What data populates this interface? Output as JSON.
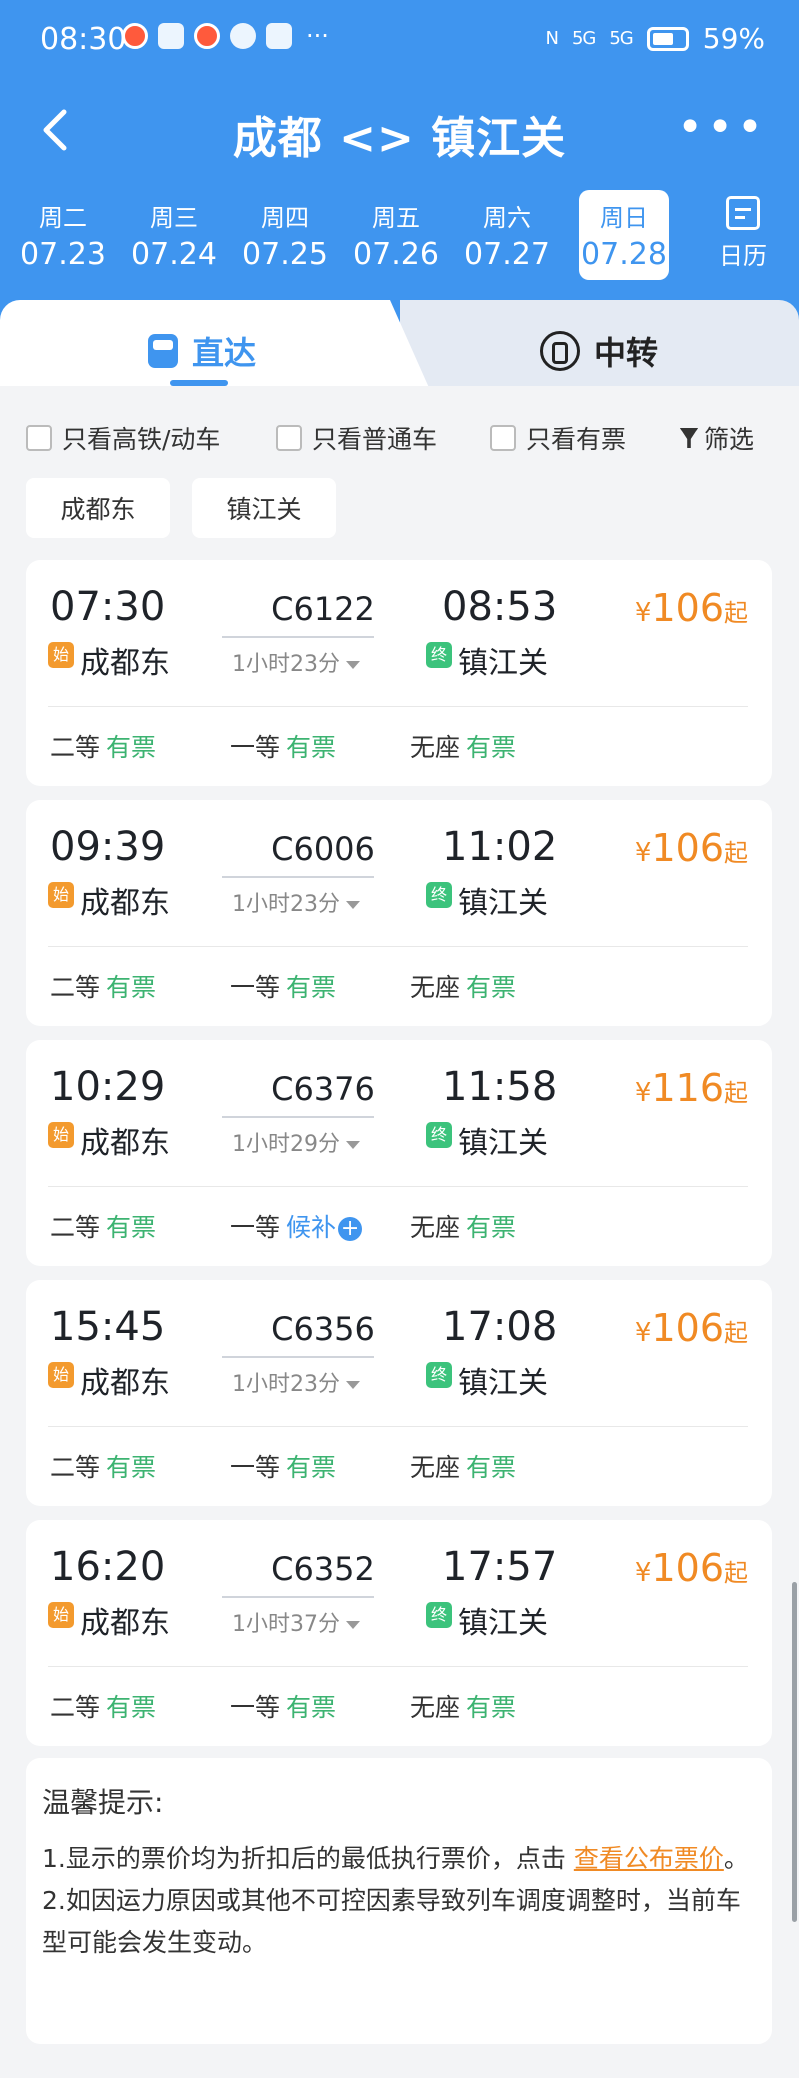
{
  "status": {
    "time": "08:30",
    "more": "···",
    "net1": "5G",
    "net2": "5G",
    "battery": "59%"
  },
  "header": {
    "title": "成都 <> 镇江关",
    "more": "•••",
    "calendar_label": "日历",
    "dates": [
      {
        "week": "周二",
        "date": "07.23"
      },
      {
        "week": "周三",
        "date": "07.24"
      },
      {
        "week": "周四",
        "date": "07.25"
      },
      {
        "week": "周五",
        "date": "07.26"
      },
      {
        "week": "周六",
        "date": "07.27"
      },
      {
        "week": "周日",
        "date": "07.28",
        "selected": true
      }
    ]
  },
  "tabs": {
    "direct": "直达",
    "transfer": "中转"
  },
  "filters": {
    "high_speed": "只看高铁/动车",
    "normal": "只看普通车",
    "available": "只看有票",
    "screen": "筛选"
  },
  "station_chips": [
    "成都东",
    "镇江关"
  ],
  "badges": {
    "start": "始",
    "end": "终"
  },
  "trains": [
    {
      "dep": "07:30",
      "no": "C6122",
      "arr": "08:53",
      "dur": "1小时23分",
      "from": "成都东",
      "to": "镇江关",
      "yen": "¥",
      "price": "106",
      "suffix": "起",
      "seats": [
        {
          "cls": "二等",
          "st": "有票"
        },
        {
          "cls": "一等",
          "st": "有票"
        },
        {
          "cls": "无座",
          "st": "有票"
        }
      ]
    },
    {
      "dep": "09:39",
      "no": "C6006",
      "arr": "11:02",
      "dur": "1小时23分",
      "from": "成都东",
      "to": "镇江关",
      "yen": "¥",
      "price": "106",
      "suffix": "起",
      "seats": [
        {
          "cls": "二等",
          "st": "有票"
        },
        {
          "cls": "一等",
          "st": "有票"
        },
        {
          "cls": "无座",
          "st": "有票"
        }
      ]
    },
    {
      "dep": "10:29",
      "no": "C6376",
      "arr": "11:58",
      "dur": "1小时29分",
      "from": "成都东",
      "to": "镇江关",
      "yen": "¥",
      "price": "116",
      "suffix": "起",
      "seats": [
        {
          "cls": "二等",
          "st": "有票"
        },
        {
          "cls": "一等",
          "st": "候补"
        },
        {
          "cls": "无座",
          "st": "有票"
        }
      ]
    },
    {
      "dep": "15:45",
      "no": "C6356",
      "arr": "17:08",
      "dur": "1小时23分",
      "from": "成都东",
      "to": "镇江关",
      "yen": "¥",
      "price": "106",
      "suffix": "起",
      "seats": [
        {
          "cls": "二等",
          "st": "有票"
        },
        {
          "cls": "一等",
          "st": "有票"
        },
        {
          "cls": "无座",
          "st": "有票"
        }
      ]
    },
    {
      "dep": "16:20",
      "no": "C6352",
      "arr": "17:57",
      "dur": "1小时37分",
      "from": "成都东",
      "to": "镇江关",
      "yen": "¥",
      "price": "106",
      "suffix": "起",
      "seats": [
        {
          "cls": "二等",
          "st": "有票"
        },
        {
          "cls": "一等",
          "st": "有票"
        },
        {
          "cls": "无座",
          "st": "有票"
        }
      ]
    }
  ],
  "tips": {
    "title": "温馨提示:",
    "line1_pre": "1.显示的票价均为折扣后的最低执行票价，点击 ",
    "line1_link": "查看公布票价",
    "line1_post": "。",
    "line2": "2.如因运力原因或其他不可控因素导致列车调度调整时，当前车型可能会发生变动。"
  },
  "colors": {
    "brand_blue": "#3f95ef",
    "price_orange": "#f08a24",
    "available_green": "#3cb371",
    "start_badge": "#f39a2e",
    "end_badge": "#3cc37c"
  }
}
